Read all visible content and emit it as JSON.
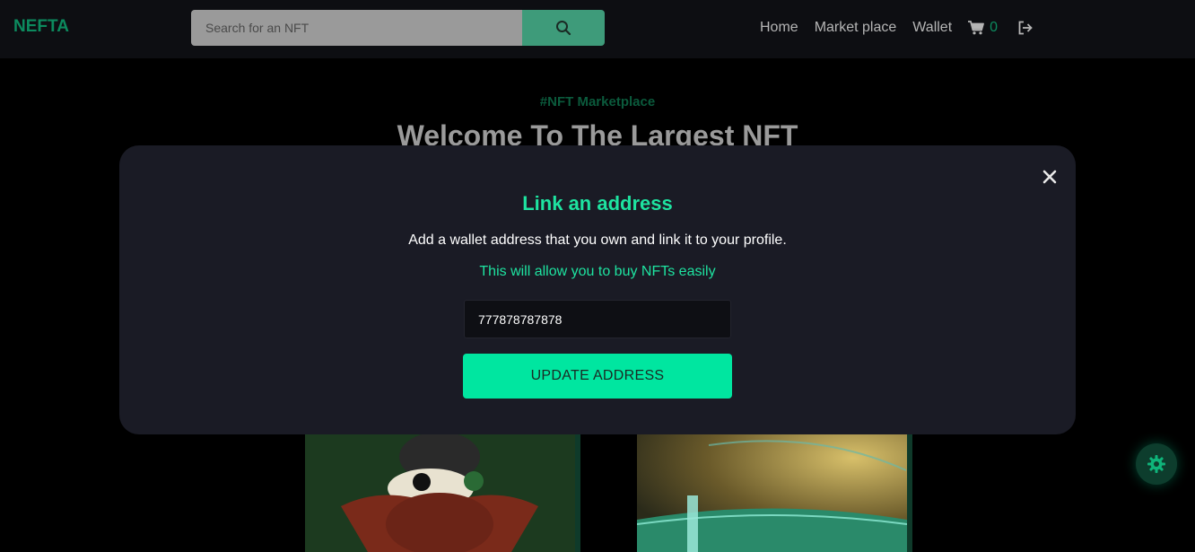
{
  "navbar": {
    "brand": "NEFTA",
    "search": {
      "placeholder": "Search for an NFT",
      "value": ""
    },
    "links": [
      "Home",
      "Market place",
      "Wallet"
    ],
    "cart_count": "0"
  },
  "hero": {
    "tag": "#NFT Marketplace",
    "title": "Welcome To The Largest NFT"
  },
  "modal": {
    "title": "Link an address",
    "description": "Add a wallet address that you own and link it to your profile.",
    "note": "This will allow you to buy NFTs easily",
    "address_value": "777878787878",
    "button_label": "UPDATE ADDRESS"
  },
  "icons": {
    "search": "search-icon",
    "cart": "cart-icon",
    "logout": "logout-icon",
    "close": "close-icon",
    "settings": "gear-icon"
  },
  "colors": {
    "accent": "#1ee3a0",
    "button": "#00e6a0",
    "brand": "#0c8a5e",
    "modal_bg": "#1a1b25",
    "navbar_bg": "#0d0e12"
  }
}
